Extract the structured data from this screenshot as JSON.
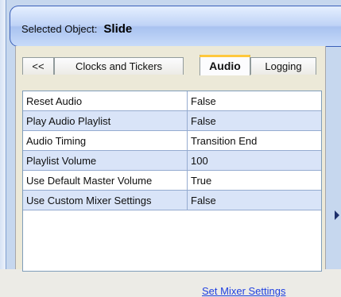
{
  "header": {
    "prefix": "Selected Object:",
    "value": "Slide"
  },
  "tabs": [
    {
      "label": "<<"
    },
    {
      "label": "Clocks and Tickers"
    },
    {
      "label": "Audio",
      "selected": true
    },
    {
      "label": "Logging"
    }
  ],
  "properties": [
    {
      "name": "Reset Audio",
      "value": "False"
    },
    {
      "name": "Play Audio Playlist",
      "value": "False"
    },
    {
      "name": "Audio Timing",
      "value": "Transition End"
    },
    {
      "name": "Playlist Volume",
      "value": "100"
    },
    {
      "name": "Use Default Master Volume",
      "value": "True"
    },
    {
      "name": "Use Custom Mixer Settings",
      "value": "False"
    }
  ],
  "link": {
    "label": "Set Mixer Settings"
  },
  "colors": {
    "header_border": "#3a5fb8",
    "row_alt": "#d9e4f8",
    "active_tab_accent": "#ffc83c",
    "link": "#1f3fe0"
  }
}
